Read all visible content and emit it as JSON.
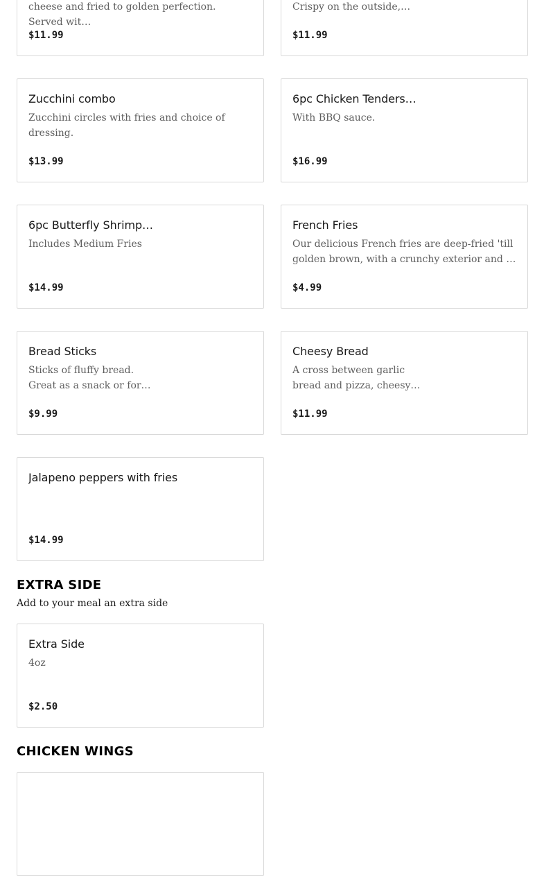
{
  "items": [
    {
      "name": "",
      "desc": "cheese and fried to golden perfection. Served wit…",
      "price": "$11.99"
    },
    {
      "name": "",
      "desc": "Crispy on the outside,…",
      "price": "$11.99"
    },
    {
      "name": "Zucchini combo",
      "desc": "Zucchini circles with fries and choice of dressing.",
      "price": "$13.99"
    },
    {
      "name": "6pc Chicken Tenders…",
      "desc": "With BBQ sauce.",
      "price": "$16.99"
    },
    {
      "name": "6pc Butterfly Shrimp…",
      "desc": "Includes Medium Fries",
      "price": "$14.99"
    },
    {
      "name": "French Fries",
      "desc": "Our delicious French fries are deep-fried 'till\ngolden brown, with a crunchy exterior and a light…",
      "price": "$4.99"
    },
    {
      "name": "Bread Sticks",
      "desc": "Sticks of fluffy bread.\nGreat as a snack or for…",
      "price": "$9.99"
    },
    {
      "name": "Cheesy Bread",
      "desc": "A cross between garlic\nbread and pizza, cheesy…",
      "price": "$11.99"
    },
    {
      "name": "Jalapeno peppers with fries",
      "desc": "",
      "price": "$14.99"
    }
  ],
  "extra_side": {
    "title": "EXTRA SIDE",
    "subtitle": "Add to your meal an extra side",
    "item": {
      "name": "Extra Side",
      "desc": "4oz",
      "price": "$2.50"
    }
  },
  "chicken_wings": {
    "title": "CHICKEN WINGS"
  }
}
